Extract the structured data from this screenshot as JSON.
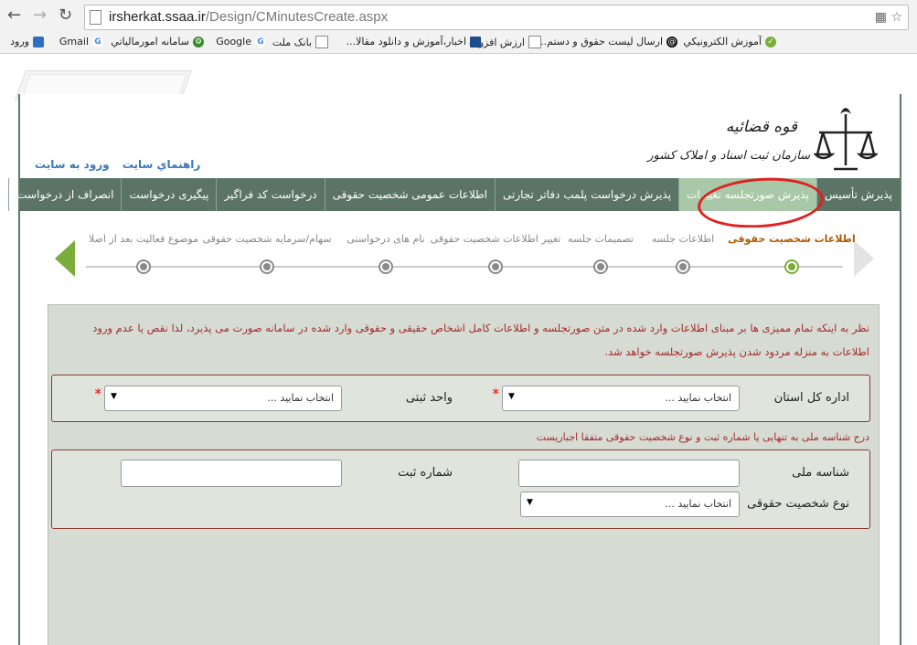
{
  "browser": {
    "url_domain": "irsherkat.ssaa.ir",
    "url_path": "/Design/CMinutesCreate.aspx",
    "back_icon": "back-arrow-icon",
    "forward_icon": "forward-arrow-icon",
    "reload_icon": "reload-icon",
    "bookmarks": [
      {
        "label": "آموزش الکترونيکي"
      },
      {
        "label": "ارسال ليست حقوق و دستم..."
      },
      {
        "label": "ارزش افزوده"
      },
      {
        "label": "اخبار،آموزش و دانلود مقالا..."
      },
      {
        "label": "بانک ملت"
      },
      {
        "label": "Google"
      },
      {
        "label": "سامانه امورمالياتي"
      },
      {
        "label": "Gmail"
      },
      {
        "label": "ورود"
      }
    ]
  },
  "site": {
    "org_name_line1": "قوه قضائیه",
    "org_name_line2": "سازمان ثبت اسناد و املاک کشور",
    "top_links": [
      "راهنماي سايت",
      "ورود به سايت"
    ]
  },
  "menu": {
    "items": [
      {
        "label": "پذيرش تأسيس"
      },
      {
        "label": "پذيرش صورتجلسه تغييرات"
      },
      {
        "label": "پذيرش درخواست پلمب دفاتر تجارتی"
      },
      {
        "label": "اطلاعات عمومی شخصيت حقوقی"
      },
      {
        "label": "درخواست کد فراگير"
      },
      {
        "label": "پيگيری درخواست"
      },
      {
        "label": "انصراف از درخواست"
      }
    ],
    "active_index": 1
  },
  "wizard": {
    "steps": [
      {
        "label": "اطلاعات شخصيت حقوقی",
        "current": true
      },
      {
        "label": "اطلاعات جلسه",
        "current": false
      },
      {
        "label": "تصميمات جلسه",
        "current": false
      },
      {
        "label": "تغيير اطلاعات شخصيت حقوقی",
        "current": false
      },
      {
        "label": "نام های درخواستی",
        "current": false
      },
      {
        "label": "سهام/سرمايه شخصيت حقوقی",
        "current": false
      },
      {
        "label": "موضوع فعاليت بعد از اصلاح",
        "current": false
      }
    ]
  },
  "form": {
    "notice": "نظر به اينكه تمام مميزی ها بر مبنای اطلاعات وارد شده در متن صورتجلسه و اطلاعات كامل اشخاص حقيقی و حقوقی وارد شده در سامانه صورت می پذيرد، لذا نقص يا عدم ورود اطلاعات به منزله مردود شدن پذيرش صورتجلسه خواهد شد.",
    "province_label": "اداره كل استان",
    "province_value": "انتخاب نماييد ...",
    "registry_unit_label": "واحد ثبتی",
    "registry_unit_value": "انتخاب نماييد ...",
    "required_mark": "*",
    "hint": "درج شناسه ملی به تنهايی يا شماره ثبت و نوع شخصيت حقوقی متفقا اجباريست",
    "national_id_label": "شناسه ملی",
    "national_id_value": "",
    "reg_number_label": "شماره ثبت",
    "reg_number_value": "",
    "entity_type_label": "نوع شخصيت حقوقی",
    "entity_type_value": "انتخاب نماييد ..."
  }
}
